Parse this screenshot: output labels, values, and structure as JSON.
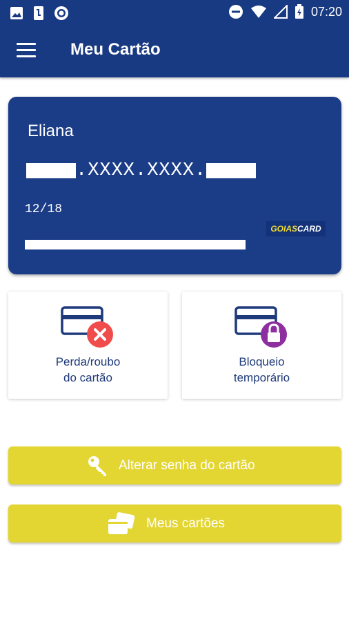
{
  "status_bar": {
    "time": "07:20",
    "left_icons": [
      "image-icon",
      "phone-icon",
      "circle-app-icon"
    ],
    "right_icons": [
      "do-not-disturb-icon",
      "wifi-icon",
      "signal-icon",
      "battery-icon"
    ]
  },
  "app_bar": {
    "title": "Meu Cartão",
    "menu_icon": "hamburger-menu-icon"
  },
  "card": {
    "holder_name": "Eliana",
    "number_middle": ".XXXX.XXXX.",
    "expiry": "12/18",
    "brand_part1": "GOIAS",
    "brand_part2": "CARD",
    "background_color": "#1b3c87"
  },
  "actions": [
    {
      "line1": "Perda/roubo",
      "line2": "do cartão",
      "icon": "card-cancel-icon",
      "badge_color": "#f04c4c"
    },
    {
      "line1": "Bloqueio",
      "line2": "temporário",
      "icon": "card-lock-icon",
      "badge_color": "#8e2fa0"
    }
  ],
  "buttons": [
    {
      "label": "Alterar senha do cartão",
      "icon": "key-icon"
    },
    {
      "label": "Meus cartões",
      "icon": "cards-icon"
    }
  ],
  "colors": {
    "primary": "#183a82",
    "accent_yellow": "#e3d532",
    "label_blue": "#1e3a7a"
  }
}
